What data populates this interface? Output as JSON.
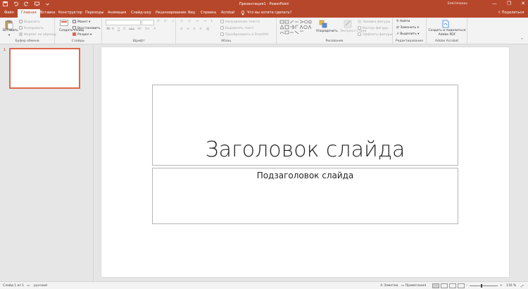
{
  "window": {
    "title": "Презентация1 - PowerPoint",
    "user": "Emil Imanov",
    "controls": [
      "—",
      "❐",
      "✕"
    ]
  },
  "tabs": [
    "Файл",
    "Главная",
    "Вставка",
    "Конструктор",
    "Переходы",
    "Анимация",
    "Слайд-шоу",
    "Рецензирование",
    "Вид",
    "Справка",
    "Acrobat"
  ],
  "tell_me": "Что вы хотите сделать?",
  "share": "Поделиться",
  "ribbon": {
    "clipboard": {
      "paste": "Вставить",
      "cut": "Вырезать",
      "copy": "Копировать",
      "format_painter": "Формат по образцу",
      "label": "Буфер обмена"
    },
    "slides": {
      "new_slide": "Создать слайд",
      "layout": "Макет",
      "reset": "Восстановить",
      "section": "Раздел",
      "label": "Слайды"
    },
    "font": {
      "label": "Шрифт"
    },
    "paragraph": {
      "text_direction": "Направление текста",
      "align_text": "Выровнять текст",
      "smartart": "Преобразовать в SmartArt",
      "label": "Абзац"
    },
    "drawing": {
      "arrange": "Упорядочить",
      "quick_styles": "Экспресс-стили",
      "shape_fill": "Заливка фигуры",
      "shape_outline": "Контур фигуры",
      "shape_effects": "Эффекты фигуры",
      "label": "Рисование"
    },
    "editing": {
      "find": "Найти",
      "replace": "Заменить",
      "select": "Выделить",
      "label": "Редактирование"
    },
    "acrobat": {
      "create_pdf": "Создать и поделиться Adobe PDF",
      "label": "Adobe Acrobat"
    }
  },
  "slides_pane": {
    "thumbnail_number": "1"
  },
  "slide": {
    "title": "Заголовок слайда",
    "subtitle": "Подзаголовок слайда"
  },
  "status": {
    "slide_info": "Слайд 1 из 1",
    "language": "русский",
    "notes": "Заметки",
    "comments": "Примечания",
    "zoom": "116 %"
  },
  "colors": {
    "accent": "#b7472a",
    "selection": "#e0674c"
  }
}
